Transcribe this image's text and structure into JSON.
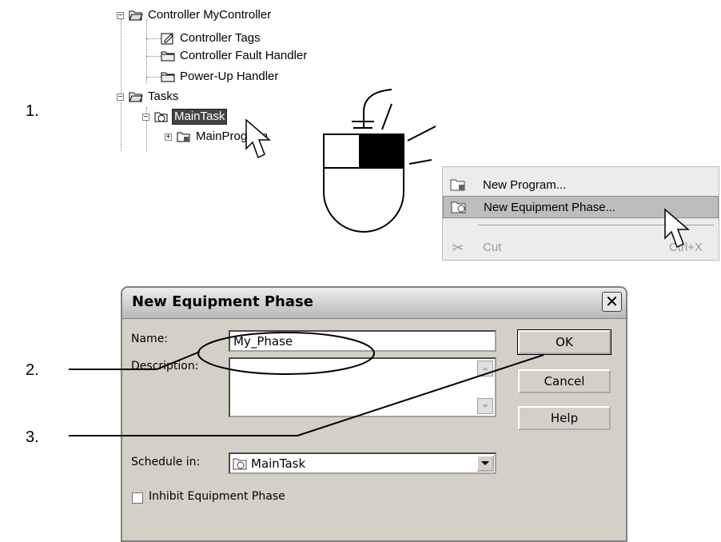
{
  "steps": {
    "s1": "1.",
    "s2": "2.",
    "s3": "3."
  },
  "tree": {
    "controller": "Controller MyController",
    "controller_tags": "Controller Tags",
    "fault_handler": "Controller Fault Handler",
    "powerup_handler": "Power-Up Handler",
    "tasks": "Tasks",
    "main_task": "MainTask",
    "main_program": "MainProgram"
  },
  "context_menu": {
    "new_program": "New Program...",
    "new_equipment_phase": "New Equipment Phase...",
    "cut": "Cut",
    "cut_shortcut": "Ctrl+X"
  },
  "dialog": {
    "title": "New Equipment Phase",
    "close_glyph": "✕",
    "name_label": "Name:",
    "name_value": "My_Phase",
    "description_label": "Description:",
    "description_value": "",
    "schedule_label": "Schedule in:",
    "schedule_value": "MainTask",
    "inhibit_label": "Inhibit Equipment Phase",
    "inhibit_checked": false,
    "ok": "OK",
    "cancel": "Cancel",
    "help": "Help"
  }
}
